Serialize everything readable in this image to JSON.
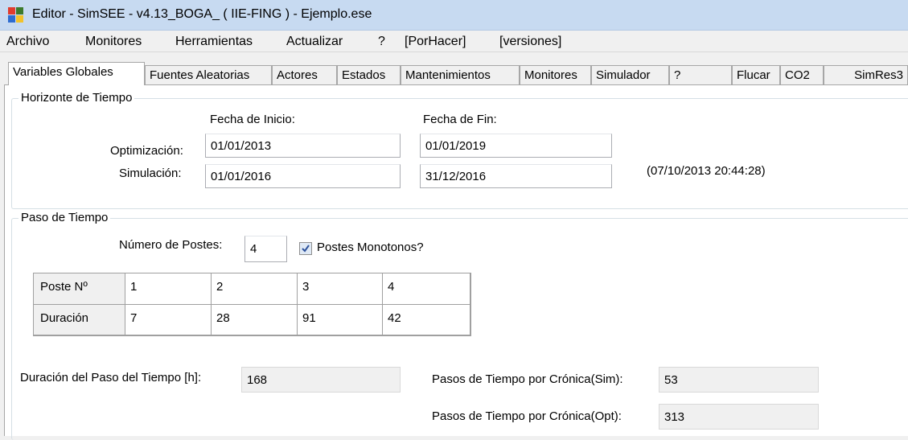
{
  "window": {
    "title": "Editor - SimSEE - v4.13_BOGA_ ( IIE-FING ) - Ejemplo.ese",
    "icon": "simsee-app-icon",
    "icon_colors": [
      "#e03b2e",
      "#3c7a2c",
      "#2e6cd0",
      "#f2c22b"
    ]
  },
  "menu": [
    "Archivo",
    "Monitores",
    "Herramientas",
    "Actualizar",
    "?",
    "[PorHacer]",
    "[versiones]"
  ],
  "tabs": [
    "Variables Globales",
    "Fuentes Aleatorias",
    "Actores",
    "Estados",
    "Mantenimientos",
    "Monitores",
    "Simulador",
    "?",
    "Flucar",
    "CO2",
    "SimRes3"
  ],
  "active_tab": "Variables Globales",
  "horizonte": {
    "title": "Horizonte de Tiempo",
    "fecha_inicio_label": "Fecha de Inicio:",
    "fecha_fin_label": "Fecha de Fin:",
    "optimizacion_label": "Optimización:",
    "simulacion_label": "Simulación:",
    "opt_inicio": "01/01/2013",
    "opt_fin": "01/01/2019",
    "sim_inicio": "01/01/2016",
    "sim_fin": "31/12/2016",
    "timestamp": "(07/10/2013 20:44:28)"
  },
  "paso": {
    "title": "Paso de Tiempo",
    "num_postes_label": "Número de Postes:",
    "num_postes": "4",
    "monotonos_label": "Postes Monotonos?",
    "monotonos_checked": true,
    "grid_row_headers": [
      "Poste Nº",
      "Duración"
    ],
    "postes": [
      "1",
      "2",
      "3",
      "4"
    ],
    "duraciones": [
      "7",
      "28",
      "91",
      "42"
    ],
    "duracion_paso_label": "Duración del Paso del Tiempo [h]:",
    "duracion_paso": "168",
    "pasos_sim_label": "Pasos de Tiempo por Crónica(Sim):",
    "pasos_sim": "53",
    "pasos_opt_label": "Pasos de Tiempo por Crónica(Opt):",
    "pasos_opt": "313"
  }
}
